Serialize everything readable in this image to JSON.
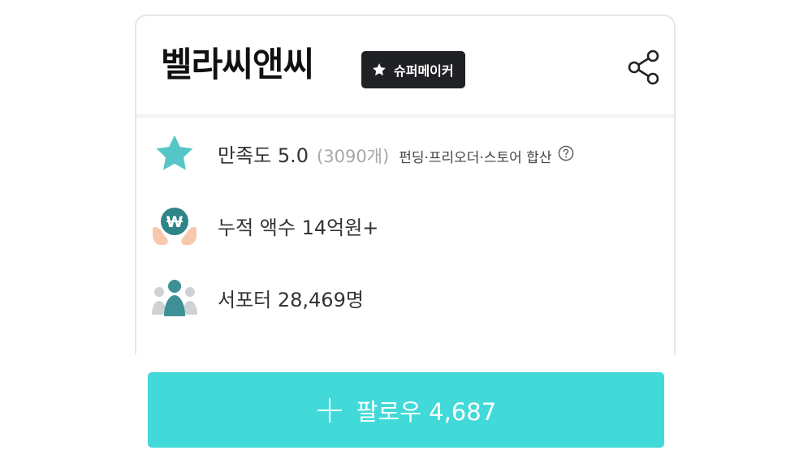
{
  "header": {
    "title": "벨라씨앤씨",
    "badge_label": "슈퍼메이커",
    "share_icon": "share-icon"
  },
  "stats": {
    "rating": {
      "icon": "star-icon",
      "label": "만족도 5.0",
      "count": "(3090개)",
      "note": "펀딩·프리오더·스토어 합산",
      "help_icon": "question-circle-icon"
    },
    "funding": {
      "icon": "won-coin-hands-icon",
      "label": "누적 액수 14억원+"
    },
    "supporters": {
      "icon": "people-icon",
      "label": "서포터 28,469명"
    }
  },
  "follow_button": {
    "icon": "plus-icon",
    "label": "팔로우 4,687"
  },
  "colors": {
    "accent": "#42d9d9",
    "star": "#55c6c8",
    "badge_bg": "#202124",
    "people": "#3d9195"
  }
}
